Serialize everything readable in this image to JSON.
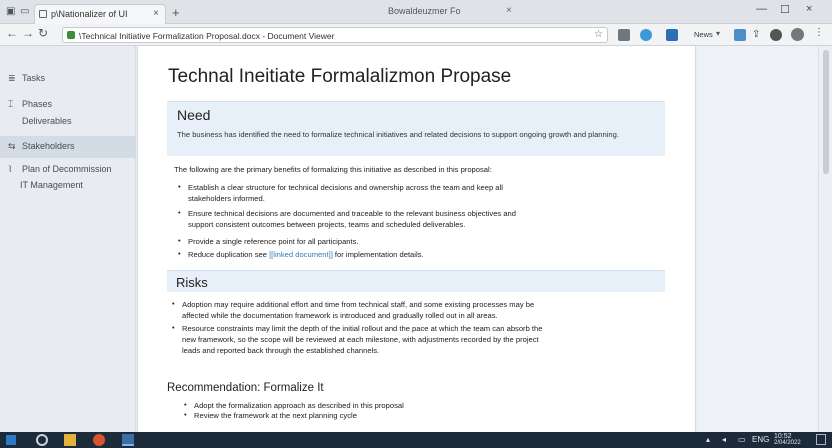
{
  "browser": {
    "tab_title": "p\\Nationalizer of UI",
    "tab_close": "×",
    "new_tab": "+",
    "window_title": "Bowaldeuzmer Fo",
    "window_title_close": "×",
    "window_controls": [
      "—",
      "☐",
      "×"
    ],
    "nav": {
      "back": "←",
      "forward": "→",
      "reload": "↻",
      "home": "⌂"
    },
    "address": "\\Technical Initiative Formalization Proposal.docx - Document Viewer",
    "extension_label": "News",
    "extension_dropdown": "▾"
  },
  "sidebar": {
    "items": [
      {
        "icon": "≣",
        "label": "Tasks"
      },
      {
        "icon": "⌶",
        "label": "Phases"
      },
      {
        "icon": "",
        "label": "Deliverables"
      },
      {
        "icon": "⇆",
        "label": "Stakeholders"
      },
      {
        "icon": "⌇",
        "label": "Plan of Decommission"
      },
      {
        "icon": "",
        "label": "IT  Management"
      }
    ]
  },
  "doc": {
    "title": "Technal Ineitiate Formalalizmon Propase",
    "need": {
      "heading": "Need",
      "text": "The business has identified the need to formalize technical initiatives and related decisions to support ongoing growth and planning."
    },
    "intro": "The following are the primary benefits of formalizing this initiative as described in this proposal:",
    "bullets": [
      [
        "Establish a clear structure for technical decisions and ownership across the team and keep all",
        "stakeholders informed."
      ],
      [
        "Ensure technical decisions are documented and traceable to the relevant business objectives and",
        "support consistent outcomes between projects, teams and scheduled deliverables."
      ],
      [
        "Provide a single reference point for all participants."
      ],
      [
        "Reduce duplication  see [[linked document]]  for implementation details."
      ]
    ],
    "bullet_link": "[[linked document]]",
    "risks": {
      "heading": "Risks"
    },
    "risk_bullets": [
      [
        "Adoption may require additional effort and time from technical staff, and some existing processes may be",
        "affected while the documentation framework is introduced and gradually rolled out in all areas."
      ],
      [
        "Resource constraints may limit the depth of the initial rollout and the pace at which the team can absorb the",
        "new framework, so the scope will be reviewed at each milestone, with adjustments recorded by the project",
        "leads and reported back through the established channels."
      ]
    ],
    "recommendations": {
      "heading": "Recommendation: Formalize It",
      "bullets": [
        "Adopt the formalization approach as described in this proposal",
        "Review the framework at the next planning cycle"
      ]
    }
  },
  "tray": {
    "lang": "ENG",
    "time": "10:52",
    "date": "2/04/2022"
  },
  "colors": {
    "accent": "#2f7fb5",
    "band": "#e7f0f8",
    "taskbar": "#1d2a3a"
  }
}
